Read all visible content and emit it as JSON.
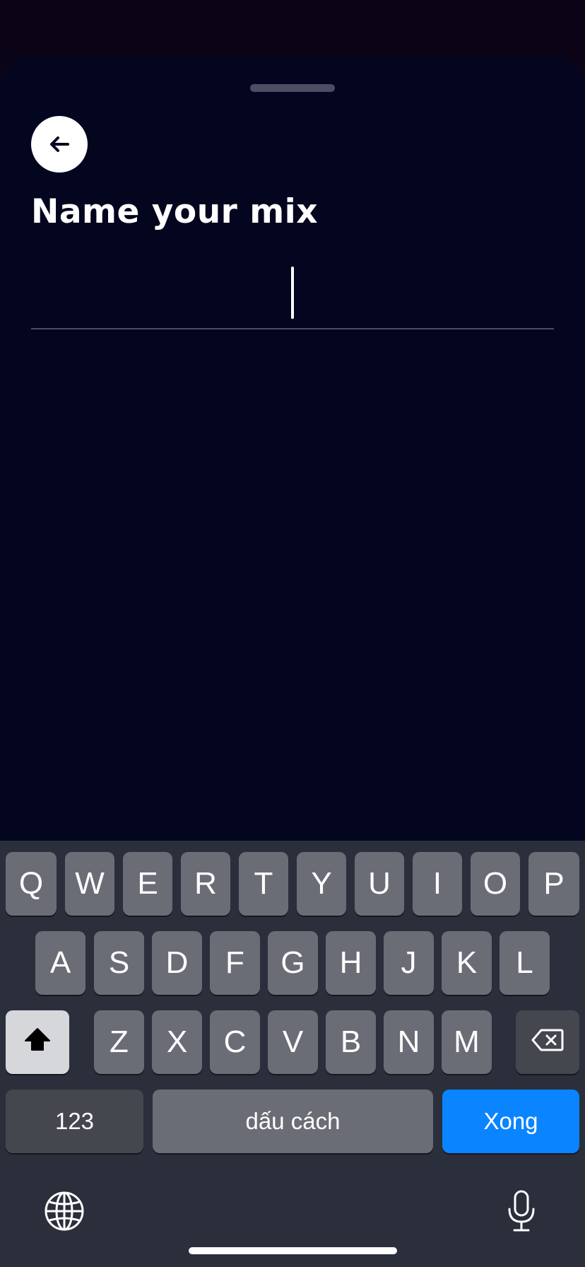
{
  "screen": {
    "title": "Name your mix",
    "name_input": {
      "value": "",
      "placeholder": ""
    },
    "back_icon": "arrow-left-icon"
  },
  "keyboard": {
    "row1": [
      "Q",
      "W",
      "E",
      "R",
      "T",
      "Y",
      "U",
      "I",
      "O",
      "P"
    ],
    "row2": [
      "A",
      "S",
      "D",
      "F",
      "G",
      "H",
      "J",
      "K",
      "L"
    ],
    "row3": [
      "Z",
      "X",
      "C",
      "V",
      "B",
      "N",
      "M"
    ],
    "numbers_label": "123",
    "space_label": "dấu cách",
    "done_label": "Xong",
    "shift_icon": "shift-icon",
    "delete_icon": "backspace-icon",
    "globe_icon": "globe-icon",
    "mic_icon": "microphone-icon"
  },
  "colors": {
    "background": "#03061e",
    "keyboard": "#2b2f3c",
    "key": "#6b6d76",
    "done_key": "#0a84ff"
  }
}
